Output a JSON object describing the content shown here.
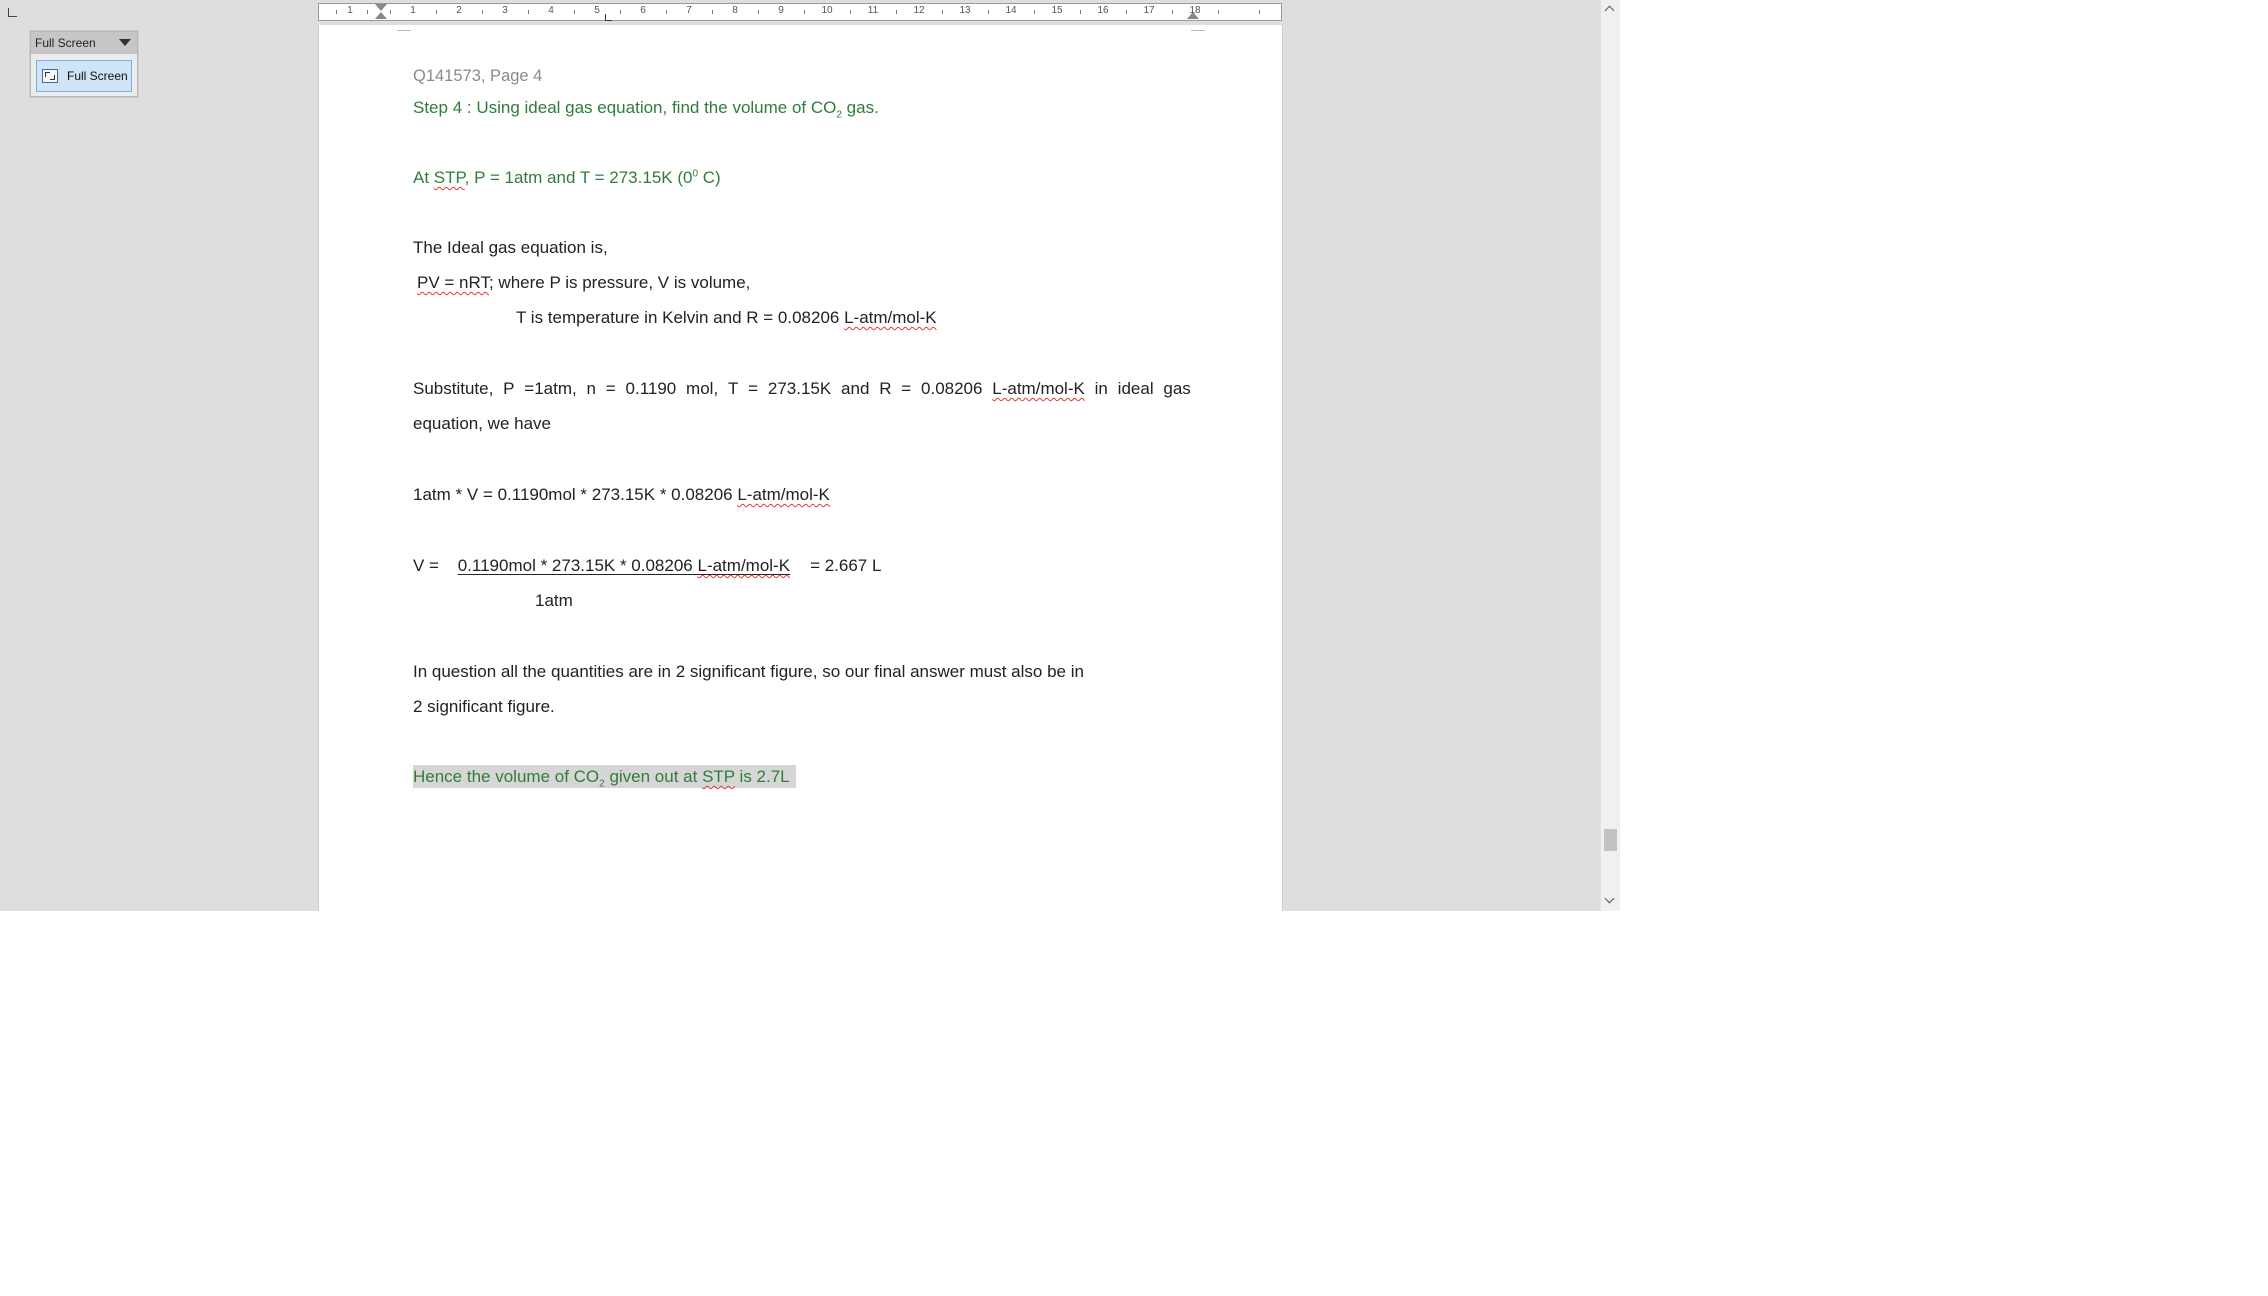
{
  "toolbar": {
    "title": "Full Screen",
    "button_label": "Full Screen",
    "button_icon": "fullscreen-icon",
    "dropdown_icon": "chevron-down-icon"
  },
  "ruler": {
    "left_numbers": [
      "1"
    ],
    "right_numbers": [
      "1",
      "2",
      "3",
      "4",
      "5",
      "6",
      "7",
      "8",
      "9",
      "10",
      "11",
      "12",
      "13",
      "14",
      "15",
      "16",
      "17",
      "18"
    ]
  },
  "document": {
    "header": "Q141573,  Page 4",
    "step_title_pre": "Step 4 :  Using ideal gas equation, find the volume of CO",
    "step_title_sub": "2",
    "step_title_post": " gas.",
    "stp_pre": "At ",
    "stp_word": "STP",
    "stp_post": ", P = 1atm and  T = 273.15K (0",
    "stp_sup": "0",
    "stp_end": " C)",
    "ideal_intro": "The Ideal gas equation is,",
    "pv_eq": "PV = nRT",
    "pv_rest": ";   where P is pressure, V is volume,",
    "temp_line_pre": "T is temperature in Kelvin and  R = 0.08206 ",
    "temp_line_unit": "L-atm/mol-K",
    "subst_words": [
      "Substitute,",
      "P",
      "=1atm,",
      "n",
      "=",
      "0.1190",
      "mol,",
      "T",
      "=",
      "273.15K",
      "and",
      "R",
      "=",
      "0.08206"
    ],
    "subst_unit": "L-atm/mol-K",
    "subst_tail": [
      "in",
      "ideal",
      "gas"
    ],
    "subst_line2": "equation, we have",
    "calc_line_pre": "1atm * V = 0.1190mol * 273.15K * 0.08206 ",
    "calc_line_unit": "L-atm/mol-K",
    "v_label": "V = ",
    "v_numerator_pre": "0.1190mol * 273.15K * 0.08206 ",
    "v_numerator_unit": "L-atm/mol-K",
    "v_result": "=  2.667 L",
    "v_denominator": "1atm",
    "sigfig_line1": "In question all the quantities are in 2 significant figure, so our final answer must also be in",
    "sigfig_line2": "2 significant figure.",
    "final_pre": "Hence the volume of CO",
    "final_sub": "2",
    "final_mid": " given out at  ",
    "final_stp": "STP",
    "final_post": "  is   2.7L"
  },
  "colors": {
    "green_text": "#2f7d3c",
    "header_gray": "#8a8a8a",
    "app_background": "#dedede",
    "highlight": "#d6d6d6",
    "spell_squiggle": "#e03a2f"
  }
}
